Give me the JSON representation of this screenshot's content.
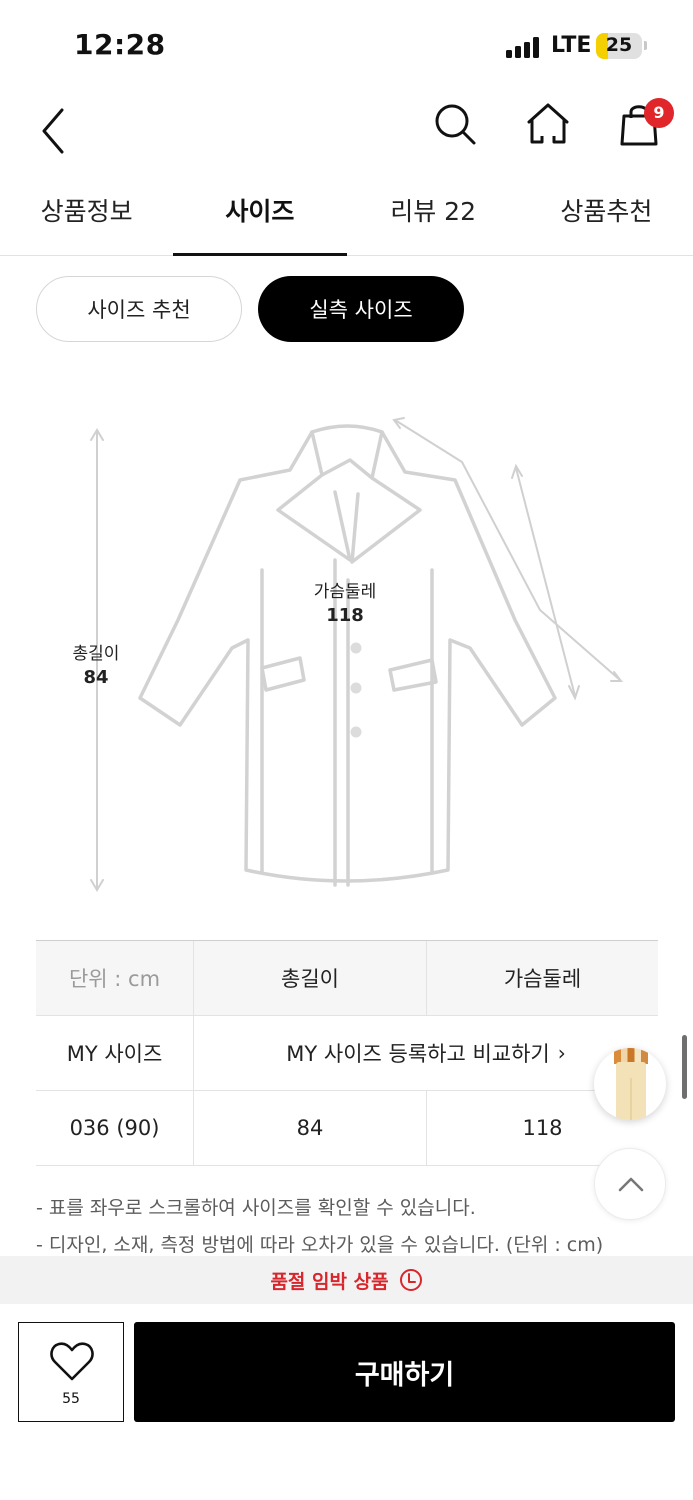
{
  "status_bar": {
    "time": "12:28",
    "network": "LTE",
    "battery": "25",
    "battery_level": 0.25
  },
  "header": {
    "cart_count": "9",
    "icons": [
      "back-icon",
      "search-icon",
      "home-icon",
      "shopping-bag-icon"
    ]
  },
  "tabs": [
    {
      "label": "상품정보",
      "active": false
    },
    {
      "label": "사이즈",
      "active": true
    },
    {
      "label": "리뷰 22",
      "active": false
    },
    {
      "label": "상품추천",
      "active": false
    }
  ],
  "size_toggle": {
    "recommend": "사이즈 추천",
    "actual": "실측 사이즈",
    "selected": "실측 사이즈"
  },
  "diagram": {
    "total_length": {
      "label": "총길이",
      "value": "84"
    },
    "chest": {
      "label": "가슴둘레",
      "value": "118"
    }
  },
  "size_table": {
    "header": [
      "단위 : cm",
      "총길이",
      "가슴둘레"
    ],
    "my_size": {
      "label": "MY 사이즈",
      "action": "MY 사이즈 등록하고 비교하기"
    },
    "rows": [
      [
        "036 (90)",
        "84",
        "118"
      ]
    ]
  },
  "notes": [
    "- 표를 좌우로 스크롤하여 사이즈를 확인할 수 있습니다.",
    "- 디자인, 소재, 측정 방법에 따라 오차가 있을 수 있습니다. (단위 : cm)"
  ],
  "soldout_notice": "품절 임박 상품",
  "bottom_bar": {
    "like_count": "55",
    "buy_label": "구매하기"
  },
  "colors": {
    "accent_red": "#d8262d",
    "badge_red": "#e0262a",
    "battery_yellow": "#f5d000",
    "primary_black": "#000000"
  }
}
